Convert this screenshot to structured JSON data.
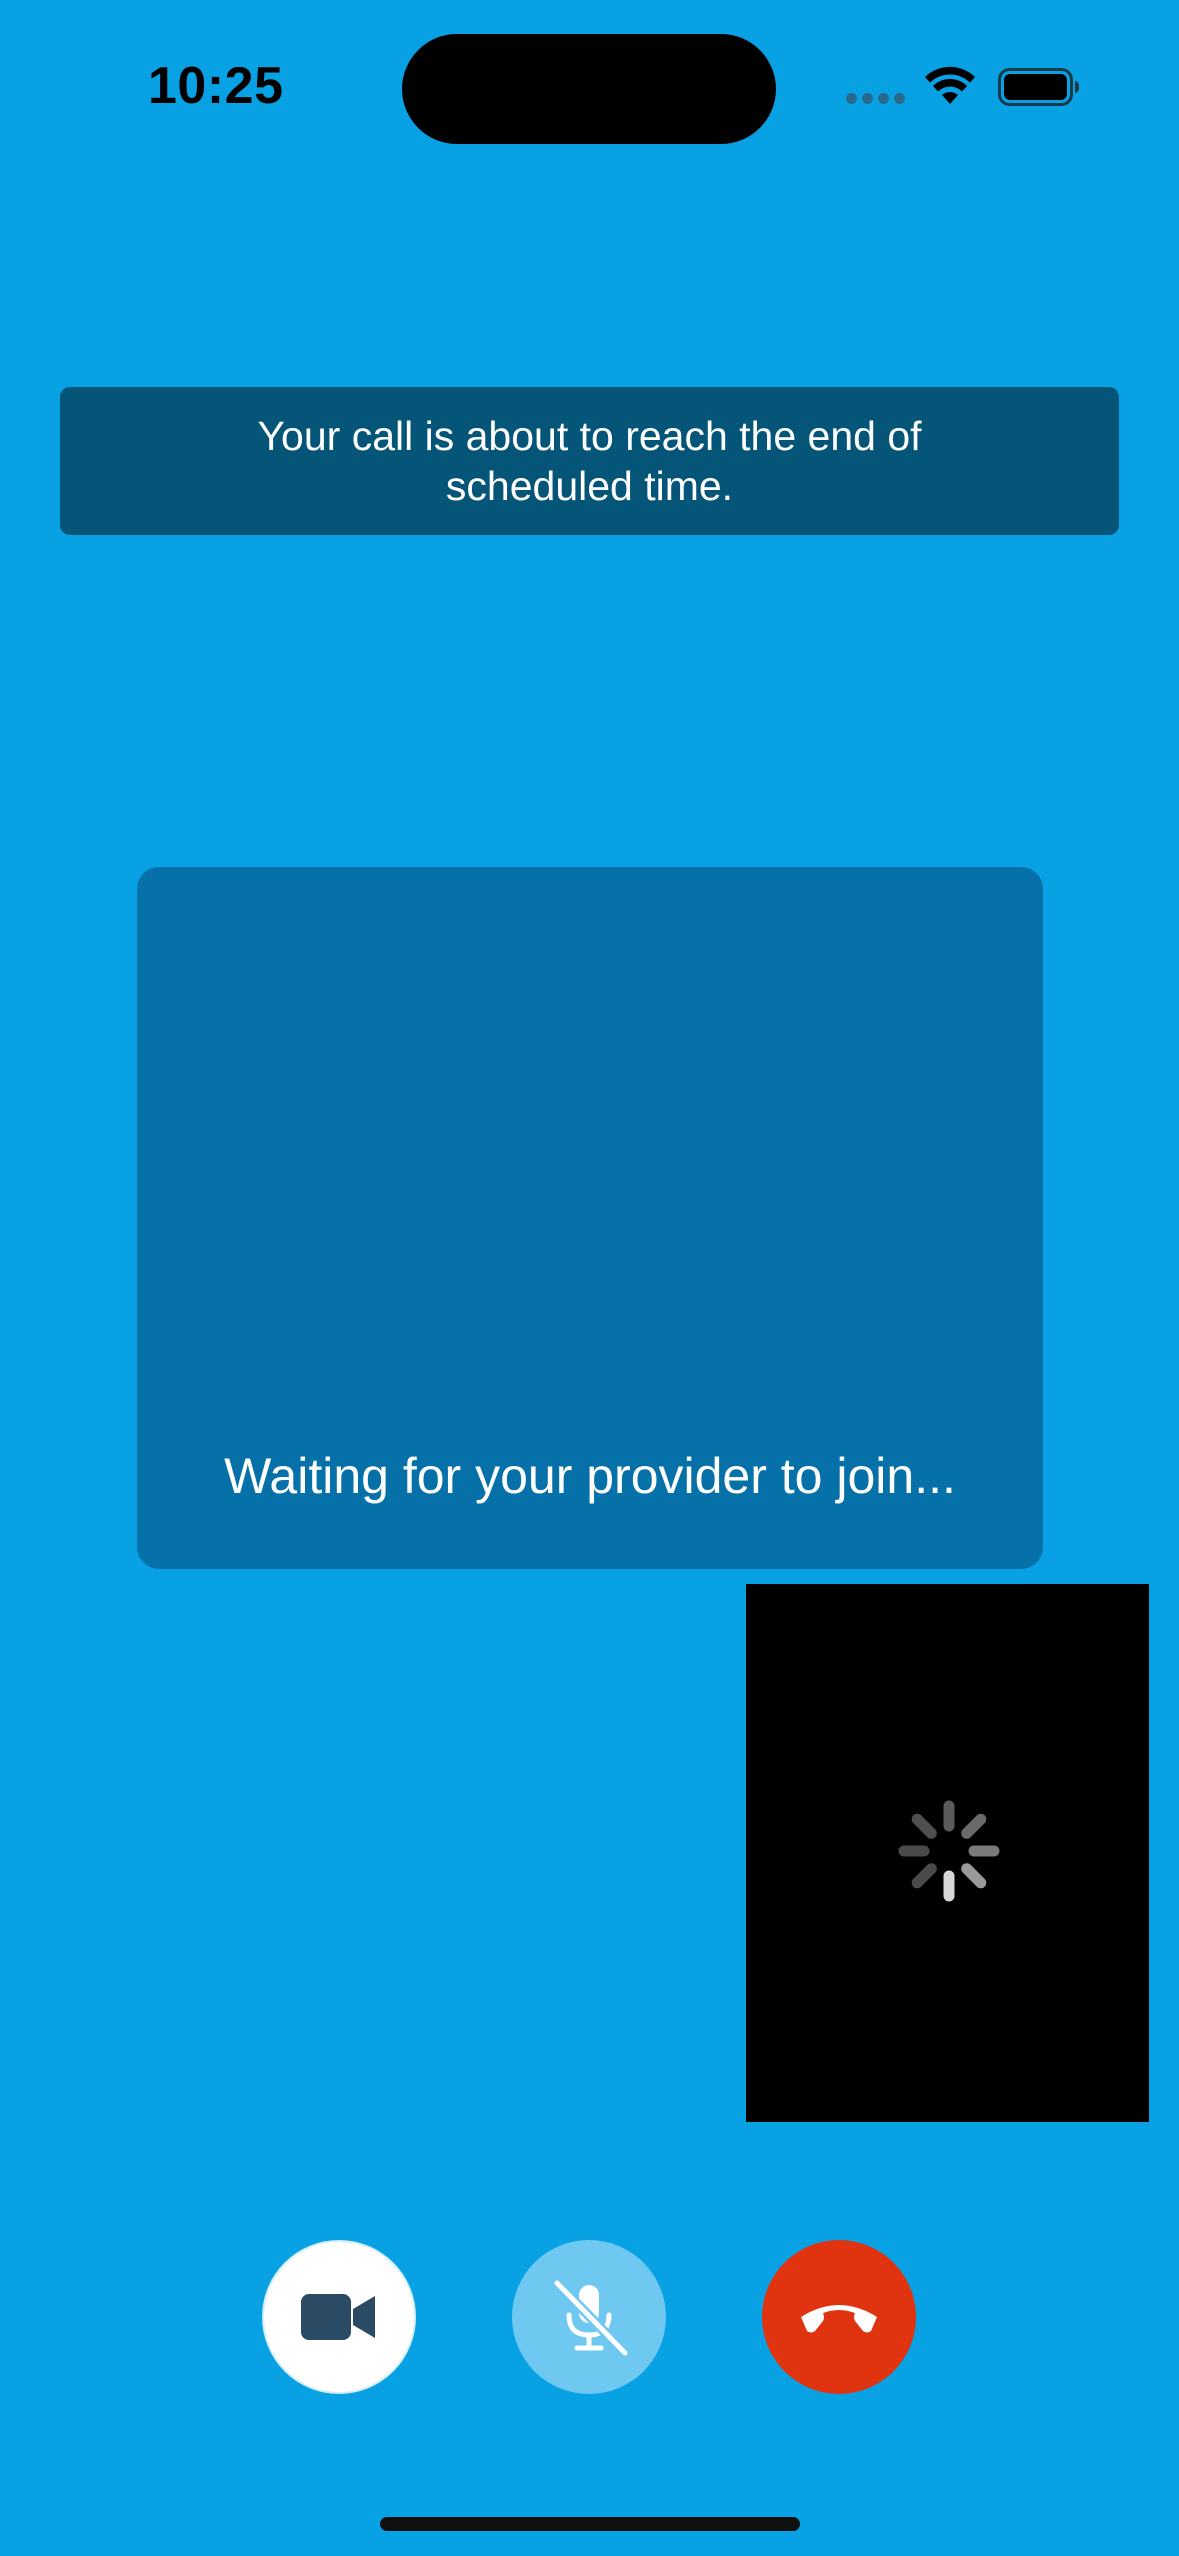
{
  "status_bar": {
    "time": "10:25",
    "wifi_icon": "wifi-icon",
    "battery_icon": "battery-icon"
  },
  "banner": {
    "message": "Your call is about to reach the end of scheduled time."
  },
  "remote_video": {
    "status_text": "Waiting for your provider to join..."
  },
  "self_view": {
    "loading_icon": "activity-spinner-icon"
  },
  "controls": [
    {
      "name": "video",
      "icon": "video-camera-icon"
    },
    {
      "name": "mute",
      "icon": "microphone-muted-icon"
    },
    {
      "name": "end_call",
      "icon": "hang-up-phone-icon"
    }
  ],
  "colors": {
    "background": "#08a1e4",
    "banner": "#045577",
    "remote_tile": "#0670a8",
    "end_call": "#e0330f",
    "mic_button": "#6fc8ef",
    "video_icon": "#2b4a63"
  }
}
